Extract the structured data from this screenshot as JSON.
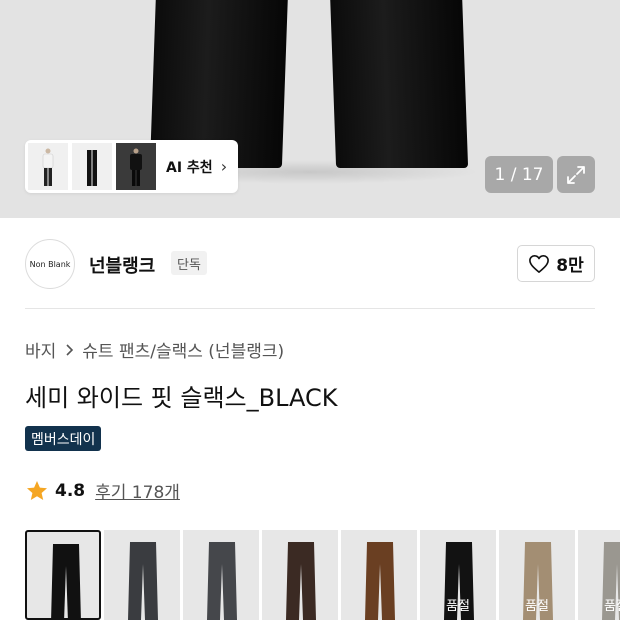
{
  "hero": {
    "ai_label": "AI 추천",
    "counter": "1 / 17"
  },
  "brand": {
    "logo_text": "Non Blank",
    "name": "넌블랭크",
    "tag": "단독",
    "likes": "8만"
  },
  "breadcrumb": {
    "category": "바지",
    "subcategory": "슈트 팬츠/슬랙스 (넌블랭크)"
  },
  "product": {
    "title": "세미 와이드 핏 슬랙스_BLACK",
    "badge": "멤버스데이"
  },
  "rating": {
    "score": "4.8",
    "reviews": "후기 178개"
  },
  "swatches": [
    {
      "color": "#111111",
      "label": ""
    },
    {
      "color": "#3a3c40",
      "label": ""
    },
    {
      "color": "#45474b",
      "label": ""
    },
    {
      "color": "#3b2a23",
      "label": ""
    },
    {
      "color": "#6a3f22",
      "label": ""
    },
    {
      "color": "#121212",
      "label": "품절"
    },
    {
      "color": "#a38e73",
      "label": "품절"
    },
    {
      "color": "#9a9790",
      "label": "품절"
    }
  ],
  "colors": {
    "badge_bg": "#12324d",
    "star": "#f5a623"
  }
}
